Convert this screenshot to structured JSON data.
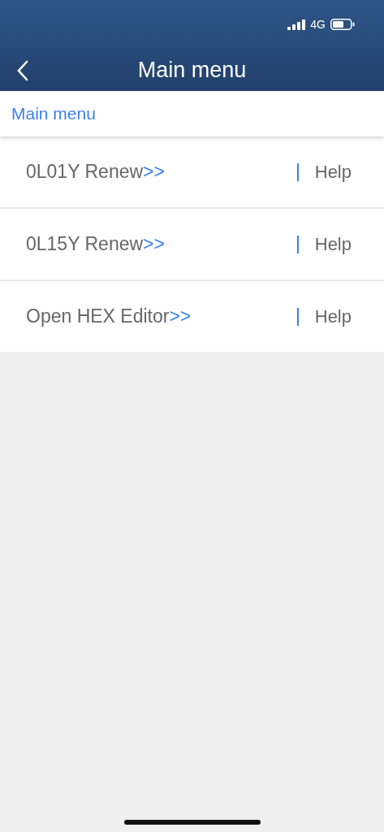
{
  "status_bar": {
    "network": "4G"
  },
  "nav_bar": {
    "title": "Main menu"
  },
  "breadcrumb": "Main menu",
  "menu_items": [
    {
      "label": "0L01Y Renew",
      "arrows": ">>",
      "help": "Help"
    },
    {
      "label": "0L15Y Renew",
      "arrows": ">>",
      "help": "Help"
    },
    {
      "label": "Open HEX Editor",
      "arrows": ">>",
      "help": "Help"
    }
  ]
}
